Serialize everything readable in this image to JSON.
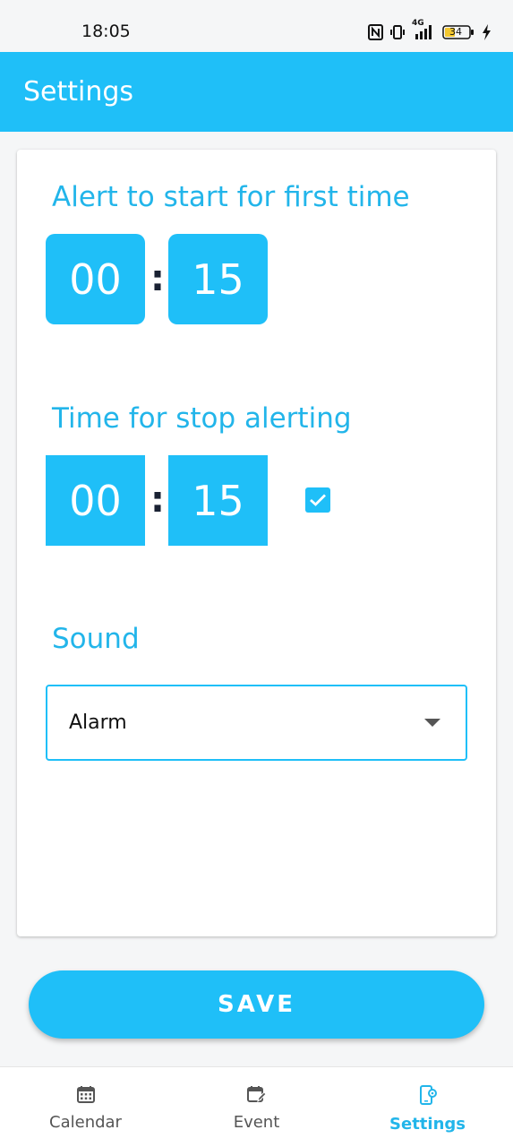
{
  "status_bar": {
    "time": "18:05",
    "battery": "34",
    "network": "4G",
    "icons": [
      "nfc-icon",
      "vibrate-icon",
      "signal-icon",
      "battery-icon",
      "charging-icon"
    ]
  },
  "app_bar": {
    "title": "Settings"
  },
  "alert_start": {
    "title": "Alert to start for first time",
    "hours": "00",
    "separator": ":",
    "minutes": "15"
  },
  "alert_stop": {
    "title": "Time for stop alerting",
    "hours": "00",
    "separator": ":",
    "minutes": "15",
    "checked": true
  },
  "sound": {
    "title": "Sound",
    "selected": "Alarm"
  },
  "save_label": "SAVE",
  "nav": {
    "items": [
      {
        "label": "Calendar",
        "icon": "calendar-icon",
        "active": false
      },
      {
        "label": "Event",
        "icon": "event-edit-icon",
        "active": false
      },
      {
        "label": "Settings",
        "icon": "phone-settings-icon",
        "active": true
      }
    ]
  },
  "colors": {
    "primary": "#1fbff8",
    "title_text": "#22b5ea",
    "background": "#f5f6f7"
  }
}
